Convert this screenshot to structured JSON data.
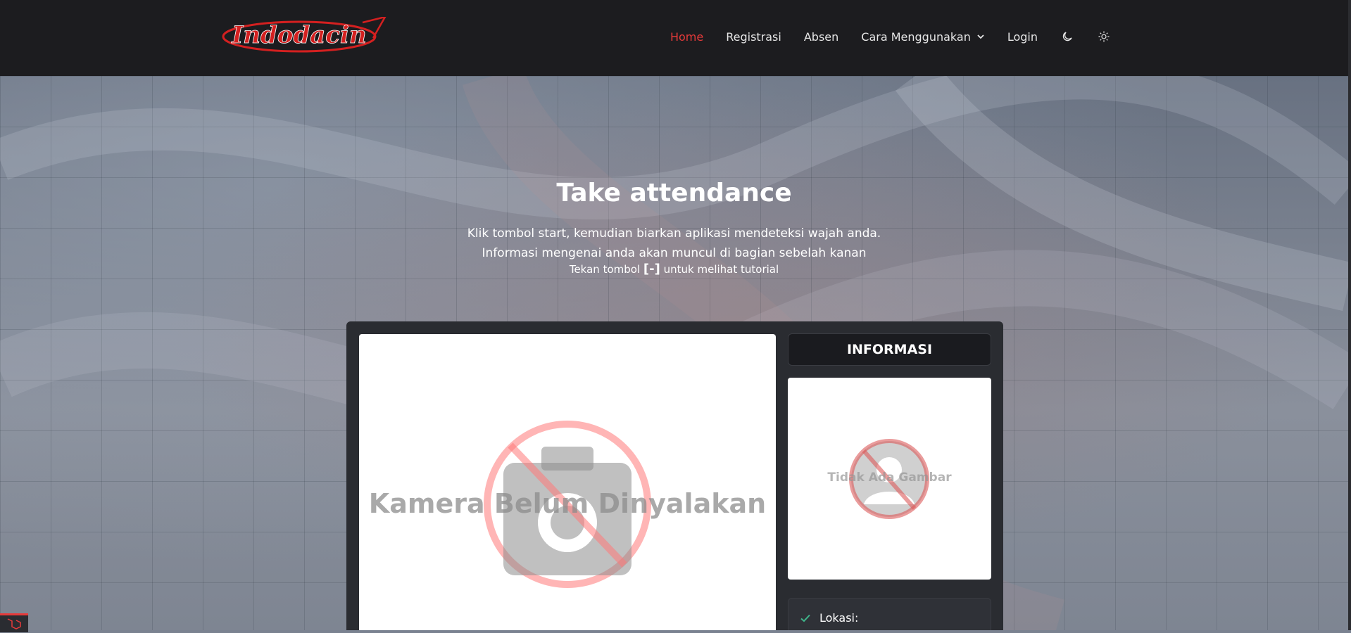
{
  "brand": {
    "logo_text": "Indodacin",
    "accent": "#e63a3a"
  },
  "nav": {
    "items": [
      {
        "label": "Home",
        "active": true
      },
      {
        "label": "Registrasi"
      },
      {
        "label": "Absen"
      },
      {
        "label": "Cara Menggunakan"
      },
      {
        "label": "Login"
      }
    ],
    "icons": [
      "moon-icon",
      "sun-icon"
    ]
  },
  "hero": {
    "title": "Take attendance",
    "line1": "Klik tombol start, kemudian biarkan aplikasi mendeteksi wajah anda.",
    "line2": "Informasi mengenai anda akan muncul di bagian sebelah kanan",
    "hint_prefix": "Tekan tombol",
    "hint_key": "[-]",
    "hint_suffix": "untuk melihat tutorial"
  },
  "camera": {
    "placeholder": "Kamera Belum Dinyalakan"
  },
  "info": {
    "header": "INFORMASI",
    "photo_placeholder": "Tidak Ada Gambar",
    "location_label": "Lokasi:"
  }
}
